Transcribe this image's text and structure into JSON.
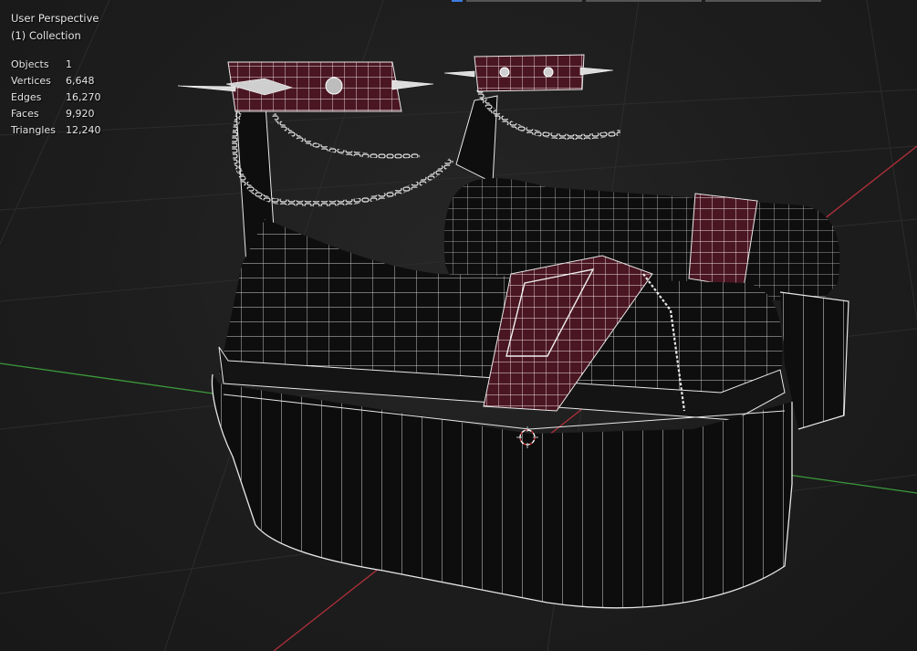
{
  "viewport": {
    "view_name": "User Perspective",
    "collection_name": "(1) Collection"
  },
  "stats": [
    {
      "label": "Objects",
      "value": "1"
    },
    {
      "label": "Vertices",
      "value": "6,648"
    },
    {
      "label": "Edges",
      "value": "16,270"
    },
    {
      "label": "Faces",
      "value": "9,920"
    },
    {
      "label": "Triangles",
      "value": "12,240"
    }
  ],
  "colors": {
    "background": "#1c1c1c",
    "grid": "#2c2c2c",
    "x_axis": "#b0303a",
    "y_axis": "#3c9a3c",
    "wire": "#e8e8e8",
    "mesh_dark": "#0e0e0e",
    "strap": "#4a1622",
    "cursor": "#d23a3a"
  },
  "icons": [
    "3d-cursor-icon"
  ]
}
